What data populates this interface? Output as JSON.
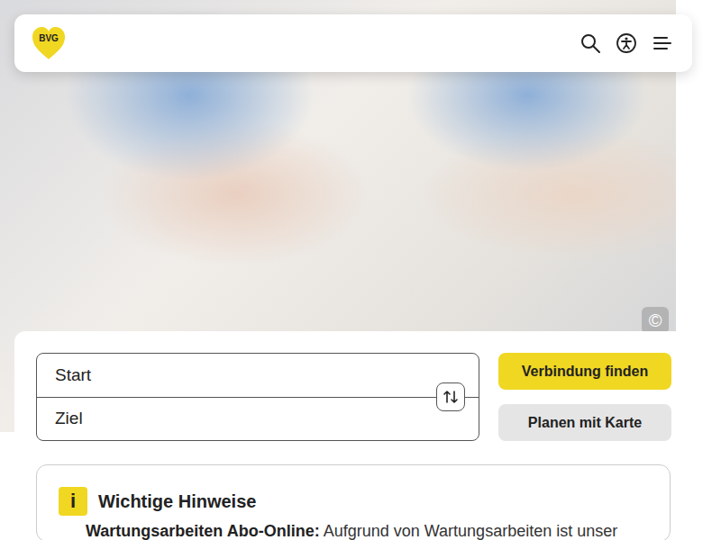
{
  "header": {
    "logo": "BVG"
  },
  "hero": {
    "copyright": "©"
  },
  "planner": {
    "start": "Start",
    "destination": "Ziel",
    "buttons": [
      "Verbindung finden",
      "Planen mit Karte"
    ]
  },
  "notice": {
    "icon": "i",
    "title": "Wichtige Hinweise",
    "items": [
      {
        "title": "Wartungsarbeiten Abo-Online:",
        "text": "Aufgrund von Wartungsarbeiten ist unser"
      }
    ]
  }
}
